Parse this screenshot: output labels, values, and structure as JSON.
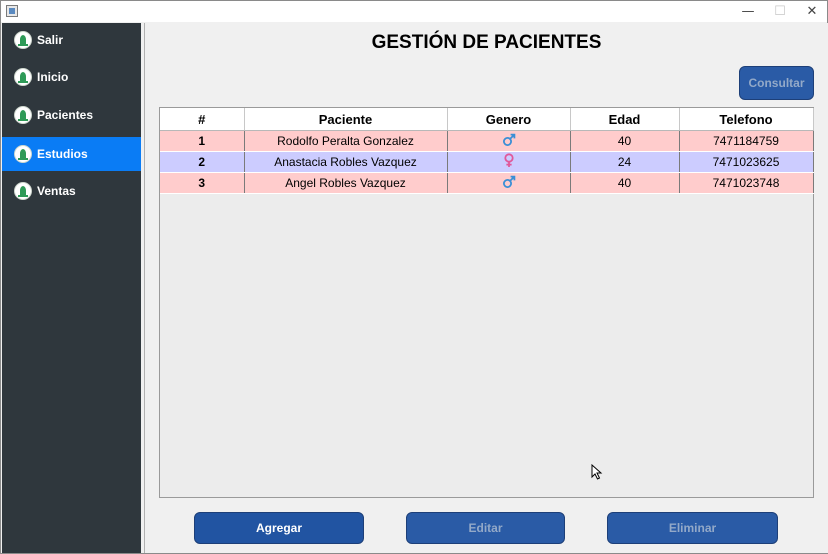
{
  "window": {
    "min": "—",
    "max": "☐",
    "close": "✕"
  },
  "sidebar": {
    "items": [
      {
        "label": "Salir",
        "icon": "logo-icon",
        "active": false
      },
      {
        "label": "Inicio",
        "icon": "logo-icon",
        "active": false
      },
      {
        "label": "Pacientes",
        "icon": "logo-icon",
        "active": false
      },
      {
        "label": "Estudios",
        "icon": "logo-icon",
        "active": true
      },
      {
        "label": "Ventas",
        "icon": "logo-icon",
        "active": false
      }
    ]
  },
  "main": {
    "title": "GESTIÓN DE PACIENTES",
    "consultar_label": "Consultar"
  },
  "table": {
    "columns": [
      "#",
      "Paciente",
      "Genero",
      "Edad",
      "Telefono"
    ],
    "rows": [
      {
        "num": "1",
        "paciente": "Rodolfo Peralta Gonzalez",
        "genero": "male-icon",
        "edad": "40",
        "telefono": "7471184759"
      },
      {
        "num": "2",
        "paciente": "Anastacia Robles Vazquez",
        "genero": "female-icon",
        "edad": "24",
        "telefono": "7471023625"
      },
      {
        "num": "3",
        "paciente": "Angel Robles Vazquez",
        "genero": "male-icon",
        "edad": "40",
        "telefono": "7471023748"
      }
    ]
  },
  "actions": {
    "agregar": "Agregar",
    "editar": "Editar",
    "eliminar": "Eliminar"
  },
  "colors": {
    "sidebar": "#2f373d",
    "active": "#0a7cf5",
    "button": "#2154a2",
    "row_pink": "#ffcccc",
    "row_lavender": "#ccccff",
    "male": "#3b8fd6",
    "female": "#e0589a"
  }
}
